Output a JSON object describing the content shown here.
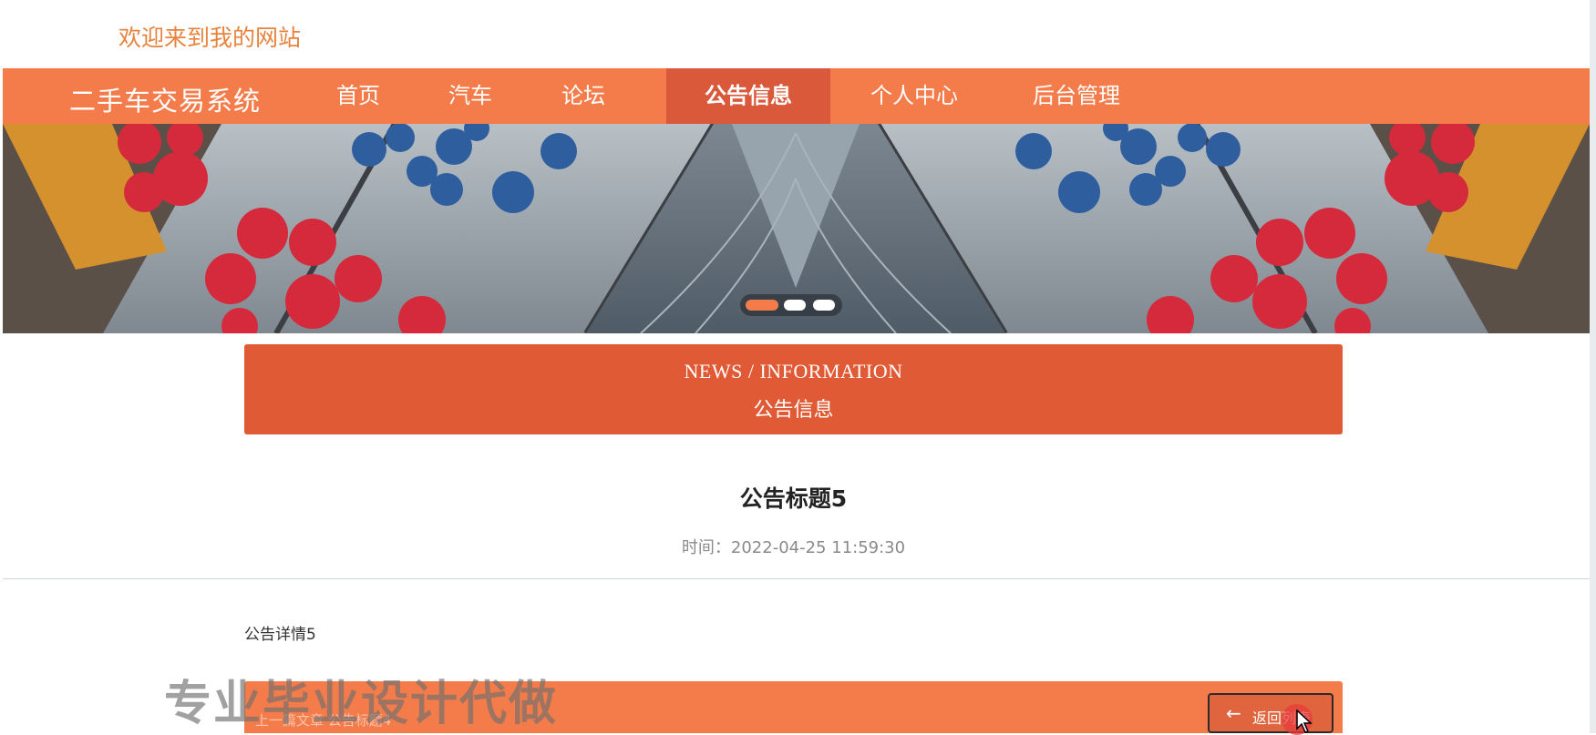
{
  "header": {
    "welcome": "欢迎来到我的网站"
  },
  "nav": {
    "brand": "二手车交易系统",
    "items": [
      {
        "label": "首页",
        "active": false
      },
      {
        "label": "汽车",
        "active": false
      },
      {
        "label": "论坛",
        "active": false
      },
      {
        "label": "公告信息",
        "active": true
      },
      {
        "label": "个人中心",
        "active": false
      },
      {
        "label": "后台管理",
        "active": false
      }
    ]
  },
  "banner": {
    "slides_total": 3,
    "active_slide": 1
  },
  "section": {
    "title_en": "NEWS / INFORMATION",
    "title_cn": "公告信息"
  },
  "article": {
    "title": "公告标题5",
    "time_label": "时间：",
    "time_value": "2022-04-25 11:59:30",
    "content": "公告详情5"
  },
  "footer": {
    "breadcrumb": "上一篇文章    公告标题4",
    "back_label": "返回列表"
  },
  "watermark": "专业毕业设计代做",
  "colors": {
    "accent": "#f47c4b",
    "accent_dark": "#e05a35",
    "welcome": "#e8833e"
  }
}
